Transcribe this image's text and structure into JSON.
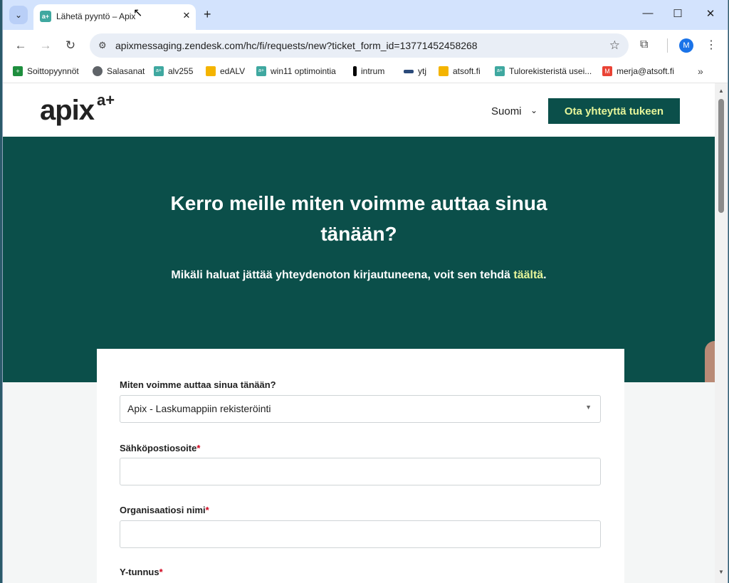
{
  "browser": {
    "tab": {
      "favicon": "a+",
      "title": "Lähetä pyyntö – Apix",
      "close": "✕"
    },
    "new_tab": "+",
    "url": "apixmessaging.zendesk.com/hc/fi/requests/new?ticket_form_id=13771452458268",
    "profile_initial": "M",
    "bookmarks": [
      {
        "label": "Soittopyynnöt",
        "icon_color": "#1e8e3e",
        "icon": "sheets-icon"
      },
      {
        "label": "Salasanat",
        "icon_color": "#5f6368",
        "icon": "globe-icon"
      },
      {
        "label": "alv255",
        "icon_color": "#3fa8a0",
        "icon": "apix-icon"
      },
      {
        "label": "edALV",
        "icon_color": "#f4b400",
        "icon": "lock-icon"
      },
      {
        "label": "win11 optimointia",
        "icon_color": "#3fa8a0",
        "icon": "apix-icon"
      },
      {
        "label": "intrum",
        "icon_color": "#000000",
        "icon": "intrum-icon"
      },
      {
        "label": "ytj",
        "icon_color": "#2b4a7a",
        "icon": "ytj-icon"
      },
      {
        "label": "atsoft.fi",
        "icon_color": "#f4b400",
        "icon": "lock-icon"
      },
      {
        "label": "Tulorekisteristä usei...",
        "icon_color": "#3fa8a0",
        "icon": "apix-icon"
      },
      {
        "label": "merja@atsoft.fi",
        "icon_color": "#ea4335",
        "icon": "gmail-icon"
      }
    ]
  },
  "site": {
    "logo": "apix",
    "logo_sup": "a+",
    "language": "Suomi",
    "contact_button": "Ota yhteyttä tukeen",
    "hero_title": "Kerro meille miten voimme auttaa sinua tänään?",
    "hero_sub_prefix": "Mikäli haluat jättää yhteydenoton kirjautuneena, voit sen tehdä ",
    "hero_sub_link": "täältä",
    "hero_sub_suffix": "."
  },
  "form": {
    "topic_label": "Miten voimme auttaa sinua tänään?",
    "topic_value": "Apix - Laskumappiin rekisteröinti",
    "email_label": "Sähköpostiosoite",
    "org_label": "Organisaatiosi nimi",
    "ytunnus_label": "Y-tunnus",
    "required_mark": "*"
  }
}
